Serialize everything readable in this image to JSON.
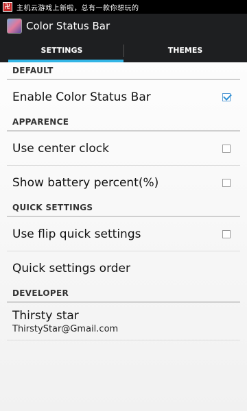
{
  "status_bar": {
    "notification_icon": "app-notification-icon",
    "notification_text": "主机云游戏上新啦，总有一款你想玩的"
  },
  "action_bar": {
    "app_icon": "color-status-bar-app-icon",
    "title": "Color Status Bar"
  },
  "tabs": [
    {
      "label": "SETTINGS",
      "active": true
    },
    {
      "label": "THEMES",
      "active": false
    }
  ],
  "colors": {
    "accent": "#33b5e5",
    "bar_background": "#1e1f21",
    "checkbox_checked": "#2e8fd4"
  },
  "sections": {
    "default": {
      "header": "DEFAULT",
      "items": [
        {
          "label": "Enable Color Status Bar",
          "checked": true
        }
      ]
    },
    "apparence": {
      "header": "APPARENCE",
      "items": [
        {
          "label": "Use center clock",
          "checked": false
        },
        {
          "label": "Show battery percent(%)",
          "checked": false
        }
      ]
    },
    "quick_settings": {
      "header": "QUICK SETTINGS",
      "items": [
        {
          "label": "Use flip quick settings",
          "checked": false
        },
        {
          "label": "Quick settings order"
        }
      ]
    },
    "developer": {
      "header": "DEVELOPER",
      "name": "Thirsty star",
      "email": "ThirstyStar@Gmail.com"
    }
  }
}
